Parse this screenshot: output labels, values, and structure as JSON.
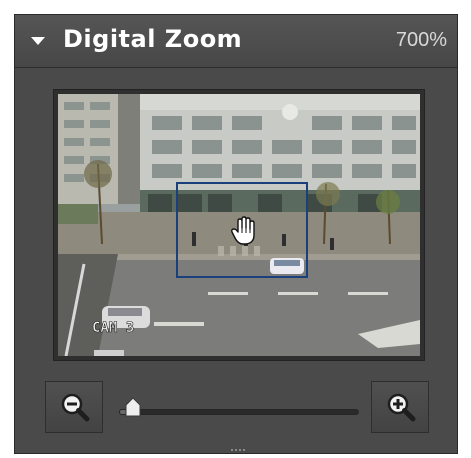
{
  "panel": {
    "title": "Digital Zoom",
    "zoom_level": "700%",
    "zoom_fraction": 0.06
  },
  "camera": {
    "overlay_text": "CAM 3"
  },
  "icons": {
    "collapse": "triangle-down-icon",
    "pan": "hand-cursor-icon",
    "zoom_out": "magnifier-minus-icon",
    "zoom_in": "magnifier-plus-icon"
  },
  "colors": {
    "panel_bg": "#4a4a4a",
    "roi_border": "#1a3f7a",
    "title_text": "#ffffff"
  }
}
